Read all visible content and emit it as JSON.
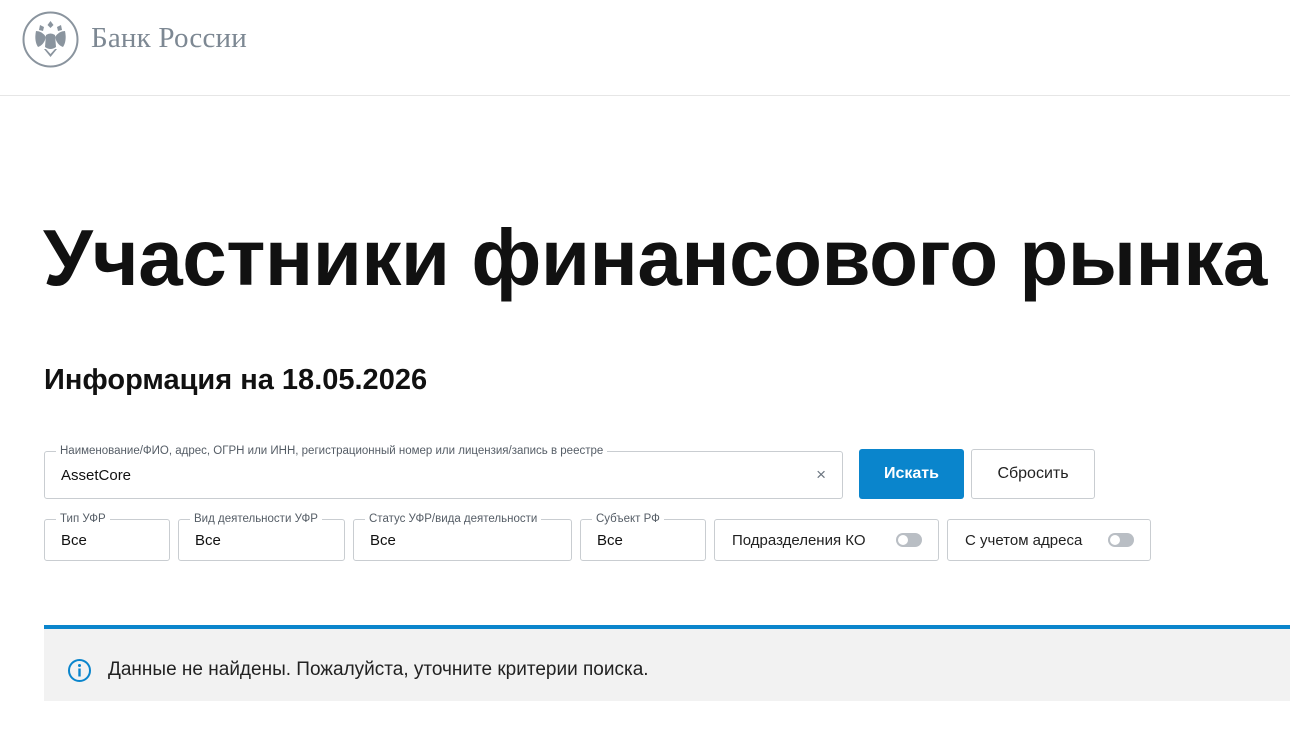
{
  "header": {
    "logo_icon": "double-headed-eagle-emblem",
    "logo_text": "Банк России"
  },
  "main": {
    "title": "Участники финансового рынка",
    "info_date": "Информация на 18.05.2026"
  },
  "search": {
    "label": "Наименование/ФИО, адрес, ОГРН или ИНН, регистрационный номер или лицензия/запись в реестре",
    "value": "AssetCore",
    "clear_icon": "×",
    "search_button": "Искать",
    "reset_button": "Сбросить"
  },
  "filters": [
    {
      "label": "Тип УФР",
      "value": "Все"
    },
    {
      "label": "Вид деятельности УФР",
      "value": "Все"
    },
    {
      "label": "Статус УФР/вида деятельности",
      "value": "Все"
    },
    {
      "label": "Субъект РФ",
      "value": "Все"
    }
  ],
  "toggles": [
    {
      "label": "Подразделения КО",
      "on": false
    },
    {
      "label": "С учетом адреса",
      "on": false
    }
  ],
  "alert": {
    "icon": "info-icon",
    "message": "Данные не найдены. Пожалуйста, уточните критерии поиска."
  },
  "colors": {
    "accent": "#0a85cc",
    "logo_gray": "#7d8893",
    "alert_bg": "#f2f2f2"
  }
}
